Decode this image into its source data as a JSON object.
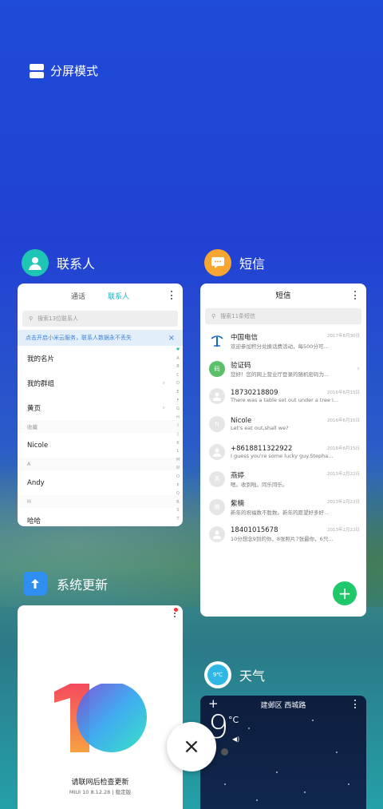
{
  "split_screen": {
    "label": "分屏模式"
  },
  "contacts": {
    "app_name": "联系人",
    "tabs": [
      "通话",
      "联系人"
    ],
    "search_placeholder": "搜索13位联系人",
    "banner": "点击开启小米云服务，联系人数据永不丢失",
    "banner_close": "×",
    "rows": [
      {
        "type": "item",
        "label": "我的名片"
      },
      {
        "type": "item",
        "label": "我的群组",
        "chevron": true
      },
      {
        "type": "item",
        "label": "黄页",
        "chevron": true
      },
      {
        "type": "section",
        "label": "收藏"
      },
      {
        "type": "item",
        "label": "Nicole"
      },
      {
        "type": "section",
        "label": "A"
      },
      {
        "type": "item",
        "label": "Andy"
      },
      {
        "type": "section",
        "label": "H"
      },
      {
        "type": "item",
        "label": "哈哈"
      }
    ],
    "alpha_index": [
      "♥",
      "A",
      "B",
      "C",
      "D",
      "E",
      "F",
      "G",
      "H",
      "I",
      "J",
      "K",
      "L",
      "M",
      "N",
      "O",
      "P",
      "Q",
      "R",
      "S",
      "T"
    ]
  },
  "sms": {
    "app_name": "短信",
    "title": "短信",
    "search_placeholder": "搜索11条短信",
    "messages": [
      {
        "name": "中国电信",
        "date": "2017年8月30日",
        "text": "欢迎参加积分兑换话费活动，每500分可...",
        "avatar": "telecom"
      },
      {
        "name": "验证码",
        "date": "",
        "text": "您好！您的网上营业厅登录的随机密码为...",
        "avatar": "code",
        "chevron": true
      },
      {
        "name": "18730218809",
        "date": "2016年6月15日",
        "text": "There was a table set out under a tree i...",
        "avatar": "person"
      },
      {
        "name": "Nicole",
        "date": "2016年6月15日",
        "text": "Let's eat out,shall we?",
        "avatar": "N"
      },
      {
        "name": "+8618811322922",
        "date": "2016年6月15日",
        "text": "I guess you're some lucky guy.Stepha...",
        "avatar": "person"
      },
      {
        "name": "燕婷",
        "date": "2013年2月22日",
        "text": "嗯。收到啦。同乐同乐。",
        "avatar": "燕"
      },
      {
        "name": "紫楠",
        "date": "2013年2月22日",
        "text": "新年的祝福数不胜数。新年的愿望好多好...",
        "avatar": "楠"
      },
      {
        "name": "18401015678",
        "date": "2013年2月22日",
        "text": "10分想念9到的你，8张照片7张最你，6只...",
        "avatar": "person"
      }
    ],
    "code_badge": "码",
    "fab": "+"
  },
  "update": {
    "app_name": "系统更新",
    "caption": "请联网后检查更新",
    "version": "MIUI 10 8.12.28 | 稳定版"
  },
  "weather": {
    "app_name": "天气",
    "icon_text": "9℃",
    "location": "建邺区 西城路",
    "temp": "9",
    "unit": "°C",
    "add": "+"
  },
  "close": "×",
  "colors": {
    "contacts": "#1ec4b4",
    "sms": "#f7a731",
    "update": "#2e8ff0",
    "weather": "#2fb8e6",
    "fab": "#1fc86a"
  }
}
